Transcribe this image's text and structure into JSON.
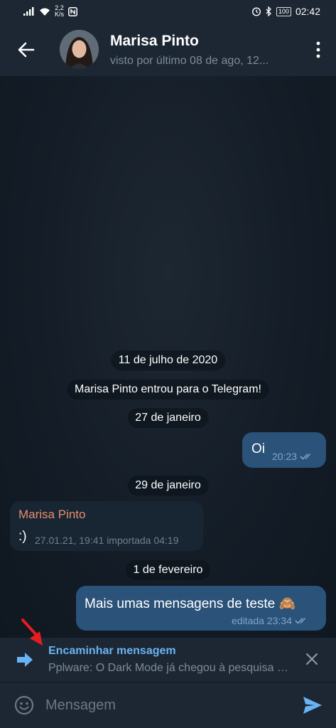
{
  "status_bar": {
    "net_speed_value": "2,2",
    "net_speed_unit": "K/s",
    "battery": "100",
    "time": "02:42"
  },
  "header": {
    "contact_name": "Marisa Pinto",
    "last_seen": "visto por último 08 de ago, 12..."
  },
  "chat": {
    "date_1": "11 de julho de 2020",
    "joined_notice": "Marisa Pinto entrou para o Telegram!",
    "date_2": "27 de janeiro",
    "msg_1": {
      "text": "Oi",
      "time": "20:23"
    },
    "date_3": "29 de janeiro",
    "msg_2": {
      "sender": "Marisa Pinto",
      "text": ":)",
      "meta": "27.01.21, 19:41 importada 04:19"
    },
    "date_4": "1 de fevereiro",
    "msg_3": {
      "text": "Mais umas mensagens de teste 🙈",
      "meta": "editada 23:34"
    }
  },
  "forward": {
    "title": "Encaminhar mensagem",
    "preview": "Pplware: O Dark Mode já chegou à pesquisa do Google"
  },
  "composer": {
    "placeholder": "Mensagem"
  },
  "icons": [
    "back-arrow-icon",
    "more-vert-icon",
    "forward-icon",
    "close-icon",
    "emoji-icon",
    "send-icon",
    "double-check-icon"
  ],
  "colors": {
    "accent": "#6ab3f3",
    "outgoing_bubble": "#2b5278",
    "incoming_bubble": "#182533",
    "sender_name": "#e88d6b"
  }
}
